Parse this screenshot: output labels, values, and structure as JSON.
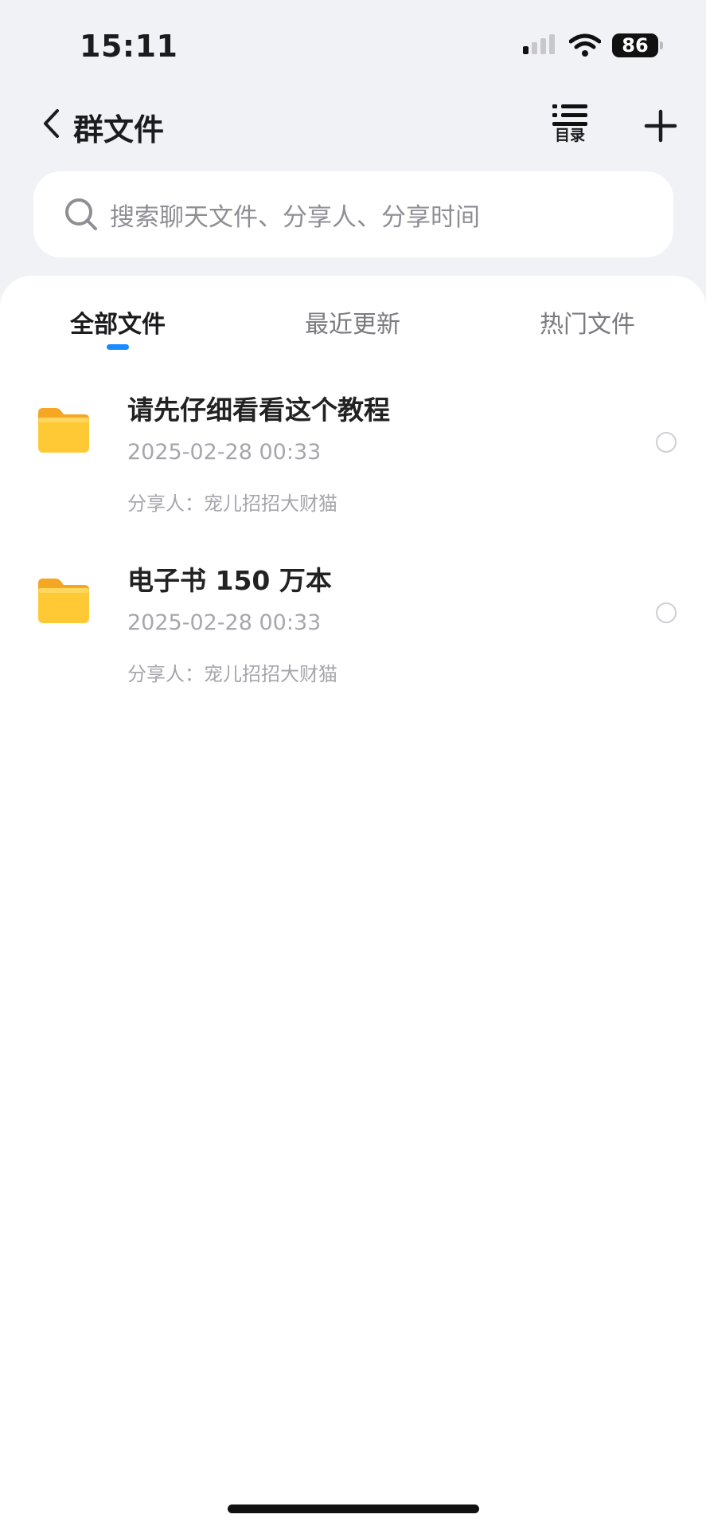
{
  "status": {
    "time": "15:11",
    "battery": "86"
  },
  "nav": {
    "title": "群文件",
    "toc_label": "目录"
  },
  "search": {
    "placeholder": "搜索聊天文件、分享人、分享时间"
  },
  "tabs": [
    {
      "label": "全部文件",
      "active": true
    },
    {
      "label": "最近更新",
      "active": false
    },
    {
      "label": "热门文件",
      "active": false
    }
  ],
  "files": [
    {
      "name": "请先仔细看看这个教程",
      "time": "2025-02-28 00:33",
      "sharer": "分享人：宠儿招招大财猫",
      "icon": "folder-icon"
    },
    {
      "name": "电子书 150 万本",
      "time": "2025-02-28 00:33",
      "sharer": "分享人：宠儿招招大财猫",
      "icon": "folder-icon"
    }
  ],
  "colors": {
    "accent": "#1a8cff",
    "folder": "#ffc21e",
    "background": "#f1f2f6"
  }
}
